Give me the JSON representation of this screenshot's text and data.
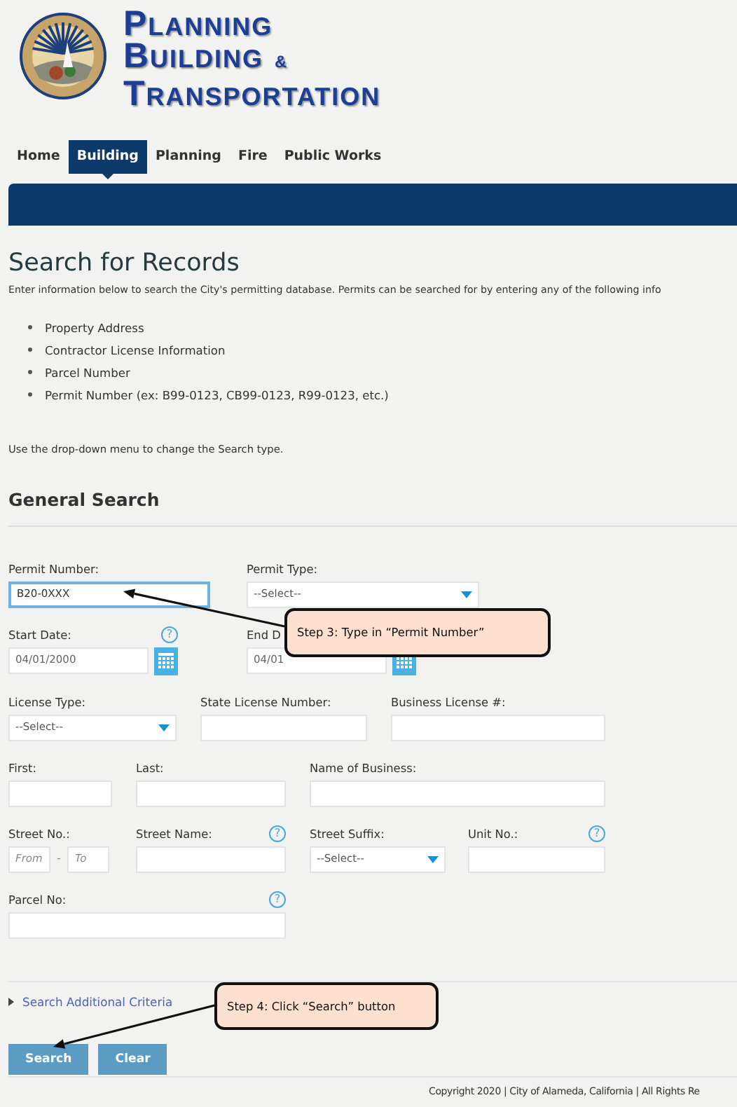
{
  "header": {
    "title_lines": [
      "Planning",
      "Building",
      "Transportation"
    ],
    "ampersand": "&"
  },
  "nav": [
    {
      "label": "Home",
      "selected": false
    },
    {
      "label": "Building",
      "selected": true
    },
    {
      "label": "Planning",
      "selected": false
    },
    {
      "label": "Fire",
      "selected": false
    },
    {
      "label": "Public Works",
      "selected": false
    }
  ],
  "page_title": "Search for Records",
  "intro": "Enter information below to search the City's permitting database. Permits can be searched for by entering any of the following info",
  "bullets": [
    "Property Address",
    "Contractor License Information",
    "Parcel Number",
    "Permit Number (ex: B99-0123, CB99-0123, R99-0123, etc.)"
  ],
  "hint": "Use the drop-down menu to change the Search type.",
  "section_title": "General Search",
  "form_rows": [
    [
      {
        "kind": "text",
        "label": "Permit Number:",
        "value": "B20-0XXX",
        "focused": true
      },
      {
        "kind": "select",
        "label": "Permit Type:",
        "value": "--Select--"
      }
    ],
    [
      {
        "kind": "date",
        "label": "Start Date:",
        "value": "04/01/2000",
        "help": "?"
      },
      {
        "kind": "date",
        "label": "End D",
        "value": "04/01"
      }
    ],
    [
      {
        "kind": "select",
        "label": "License Type:",
        "value": "--Select--"
      },
      {
        "kind": "text",
        "label": "State License Number:"
      },
      {
        "kind": "text",
        "label": "Business License #:"
      }
    ],
    [
      {
        "kind": "text",
        "label": "First:"
      },
      {
        "kind": "text",
        "label": "Last:"
      },
      {
        "kind": "text",
        "label": "Name of Business:"
      }
    ],
    [
      {
        "kind": "range",
        "label": "Street No.:",
        "placeholder": "From",
        "separator": "-",
        "placeholder_2": "To"
      },
      {
        "kind": "text",
        "label": "Street Name:",
        "help": "?"
      },
      {
        "kind": "select",
        "label": "Street Suffix:",
        "value": "--Select--"
      },
      {
        "kind": "text",
        "label": "Unit No.:",
        "help": "?"
      }
    ],
    [
      {
        "kind": "text",
        "label": "Parcel No:",
        "help": "?"
      }
    ]
  ],
  "more_link": "Search Additional Criteria",
  "buttons": [
    "Search",
    "Clear"
  ],
  "copyright": "Copyright 2020 | City of Alameda, California | All Rights Re",
  "callouts": [
    "Step 3: Type in “Permit Number”",
    "Step 4: Click “Search” button"
  ]
}
